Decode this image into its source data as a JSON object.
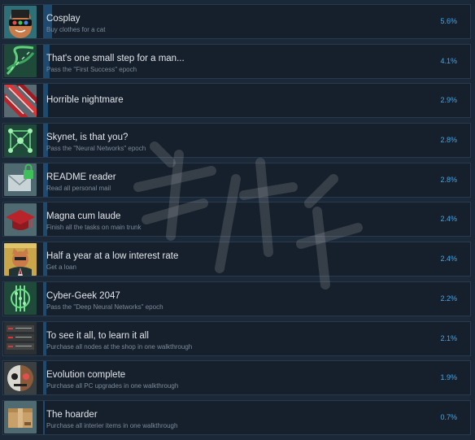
{
  "achievements": [
    {
      "name": "Cosplay",
      "description": "Buy clothes for a cat",
      "percent": "5.6%",
      "rate": 0.056,
      "icon": "cat-cosplay-icon"
    },
    {
      "name": "That's one small step for a man...",
      "description": "Pass the \"First Success\" epoch",
      "percent": "4.1%",
      "rate": 0.041,
      "icon": "dna-icon"
    },
    {
      "name": "Horrible nightmare",
      "description": "",
      "percent": "2.9%",
      "rate": 0.029,
      "icon": "claw-scratch-icon"
    },
    {
      "name": "Skynet, is that you?",
      "description": "Pass the \"Neural Networks\" epoch",
      "percent": "2.8%",
      "rate": 0.028,
      "icon": "network-nodes-icon"
    },
    {
      "name": "README reader",
      "description": "Read all personal mail",
      "percent": "2.8%",
      "rate": 0.028,
      "icon": "mail-lock-icon"
    },
    {
      "name": "Magna cum laude",
      "description": "Finish all the tasks on main trunk",
      "percent": "2.4%",
      "rate": 0.024,
      "icon": "graduation-cap-icon"
    },
    {
      "name": "Half a year at a low interest rate",
      "description": "Get a loan",
      "percent": "2.4%",
      "rate": 0.024,
      "icon": "banker-cat-icon"
    },
    {
      "name": "Cyber-Geek 2047",
      "description": "Pass the \"Deep Neural Networks\" epoch",
      "percent": "2.2%",
      "rate": 0.022,
      "icon": "circuit-chip-icon"
    },
    {
      "name": "To see it all, to learn it all",
      "description": "Purchase all nodes at the shop in one walkthrough",
      "percent": "2.1%",
      "rate": 0.021,
      "icon": "server-rack-icon"
    },
    {
      "name": "Evolution complete",
      "description": "Purchase all PC upgrades in one walkthrough",
      "percent": "1.9%",
      "rate": 0.019,
      "icon": "cyborg-face-icon"
    },
    {
      "name": "The hoarder",
      "description": "Purchase all interier items in one walkthrough",
      "percent": "0.7%",
      "rate": 0.007,
      "icon": "cardboard-box-icon"
    }
  ],
  "colors": {
    "background": "#1b2838",
    "row": "#16202d",
    "progress_bar": "#1e4a70",
    "percent_text": "#4aa3df",
    "title_text": "#e2e6ea",
    "desc_text": "#7c8a99"
  }
}
